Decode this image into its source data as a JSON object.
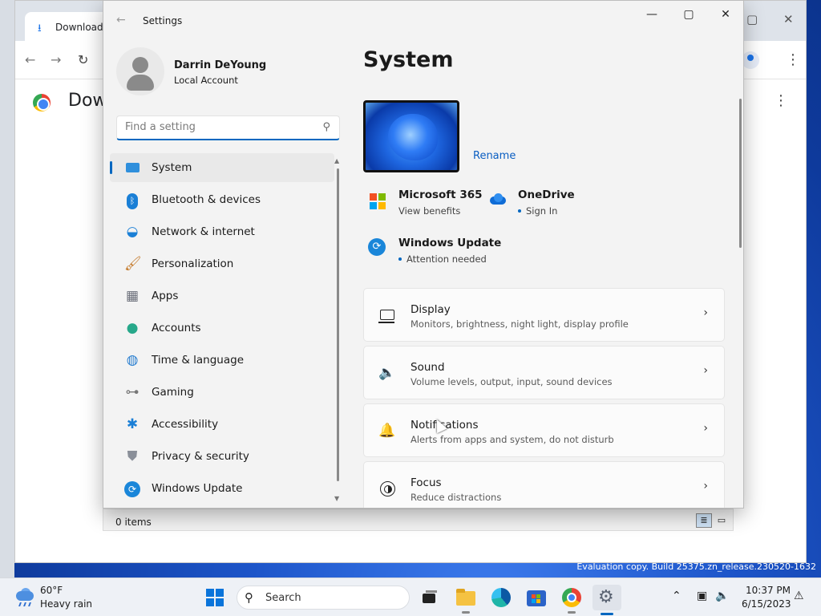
{
  "browser": {
    "tab_title": "Downloads",
    "page_heading": "Dow"
  },
  "explorer": {
    "status_items": "0 items"
  },
  "settings": {
    "app_title": "Settings",
    "user": {
      "name": "Darrin DeYoung",
      "account_type": "Local Account"
    },
    "search": {
      "placeholder": "Find a setting",
      "value": ""
    },
    "nav_items": [
      {
        "label": "System",
        "icon": "system-display-icon",
        "selected": true
      },
      {
        "label": "Bluetooth & devices",
        "icon": "bluetooth-icon"
      },
      {
        "label": "Network & internet",
        "icon": "wifi-icon"
      },
      {
        "label": "Personalization",
        "icon": "paintbrush-icon"
      },
      {
        "label": "Apps",
        "icon": "apps-icon"
      },
      {
        "label": "Accounts",
        "icon": "person-icon"
      },
      {
        "label": "Time & language",
        "icon": "globe-clock-icon"
      },
      {
        "label": "Gaming",
        "icon": "gamepad-icon"
      },
      {
        "label": "Accessibility",
        "icon": "accessibility-icon"
      },
      {
        "label": "Privacy & security",
        "icon": "shield-icon"
      },
      {
        "label": "Windows Update",
        "icon": "update-icon"
      }
    ],
    "main": {
      "title": "System",
      "rename_label": "Rename",
      "tiles": [
        {
          "title": "Microsoft 365",
          "subtitle": "View benefits"
        },
        {
          "title": "OneDrive",
          "subtitle": "Sign In"
        },
        {
          "title": "Windows Update",
          "subtitle": "Attention needed"
        }
      ],
      "cards": [
        {
          "title": "Display",
          "subtitle": "Monitors, brightness, night light, display profile",
          "icon": "monitor-icon"
        },
        {
          "title": "Sound",
          "subtitle": "Volume levels, output, input, sound devices",
          "icon": "speaker-icon"
        },
        {
          "title": "Notifications",
          "subtitle": "Alerts from apps and system, do not disturb",
          "icon": "bell-icon"
        },
        {
          "title": "Focus",
          "subtitle": "Reduce distractions",
          "icon": "focus-icon"
        }
      ]
    }
  },
  "taskbar": {
    "weather": {
      "temp": "60°F",
      "condition": "Heavy rain"
    },
    "search_label": "Search",
    "clock": {
      "time": "10:37 PM",
      "date": "6/15/2023"
    }
  },
  "watermark": "Evaluation copy. Build 25375.zn_release.230520-1632",
  "colors": {
    "accent": "#0067c0",
    "taskbar_bg": "#eef1f6",
    "window_bg": "#f3f3f3"
  }
}
